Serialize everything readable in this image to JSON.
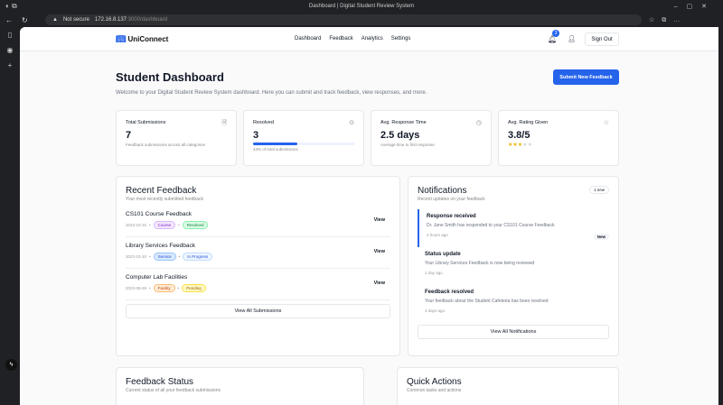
{
  "browser": {
    "tab_title": "Dashboard | Digital Student Review System",
    "security": "Not secure",
    "url_host": "172.16.8.137",
    "url_rest": ":3000/dashboard"
  },
  "nav": {
    "logo": "UniConnect",
    "links": [
      "Dashboard",
      "Feedback",
      "Analytics",
      "Settings"
    ],
    "notification_count": "3",
    "sign_out": "Sign Out"
  },
  "header": {
    "title": "Student Dashboard",
    "welcome": "Welcome to your Digital Student Review System dashboard. Here you can submit and track feedback, view responses, and more.",
    "submit_button": "Submit New Feedback"
  },
  "stats": [
    {
      "title": "Total Submissions",
      "value": "7",
      "sub": "Feedback submissions across all categories",
      "icon": "document-icon"
    },
    {
      "title": "Resolved",
      "value": "3",
      "sub": "43% of total submissions",
      "progress": 43,
      "icon": "check-circle-icon"
    },
    {
      "title": "Avg. Response Time",
      "value": "2.5 days",
      "sub": "Average time to first response",
      "icon": "clock-icon"
    },
    {
      "title": "Avg. Rating Given",
      "value": "3.8/5",
      "rating": 3.8,
      "icon": "star-icon"
    }
  ],
  "recent": {
    "title": "Recent Feedback",
    "subtitle": "Your most recently submitted feedback",
    "view_label": "View",
    "view_all": "View All Submissions",
    "items": [
      {
        "title": "CS101 Course Feedback",
        "date": "2023-10-15",
        "category": "Course",
        "status": "Resolved"
      },
      {
        "title": "Library Services Feedback",
        "date": "2023-10-10",
        "category": "Service",
        "status": "In Progress"
      },
      {
        "title": "Computer Lab Facilities",
        "date": "2023-09-28",
        "category": "Facility",
        "status": "Pending"
      }
    ]
  },
  "notifications": {
    "title": "Notifications",
    "subtitle": "Recent updates on your feedback",
    "new_count": "1 new",
    "new_label": "New",
    "view_all": "View All Notifications",
    "items": [
      {
        "title": "Response received",
        "desc": "Dr. Jane Smith has responded to your CS101 Course Feedback",
        "time": "2 hours ago"
      },
      {
        "title": "Status update",
        "desc": "Your Library Services Feedback is now being reviewed",
        "time": "1 day ago"
      },
      {
        "title": "Feedback resolved",
        "desc": "Your feedback about the Student Cafeteria has been resolved",
        "time": "3 days ago"
      }
    ]
  },
  "status_card": {
    "title": "Feedback Status",
    "subtitle": "Current status of all your feedback submissions"
  },
  "quick": {
    "title": "Quick Actions",
    "subtitle": "Common tasks and actions"
  },
  "colors": {
    "accent": "#2563eb"
  }
}
